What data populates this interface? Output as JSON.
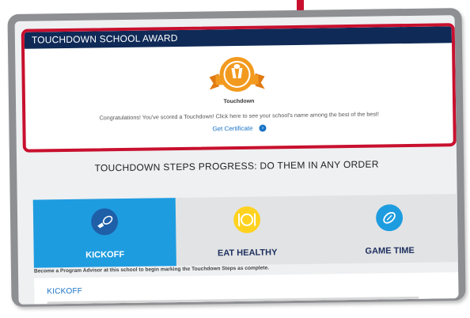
{
  "award": {
    "header": "TOUCHDOWN SCHOOL AWARD",
    "badge_label": "Touchdown",
    "message": "Congratulations! You've scored a Touchdown! Click here to see your school's name among the best of the best!",
    "certificate_link": "Get Certificate",
    "badge_color": "#f29a1f"
  },
  "progress": {
    "title": "TOUCHDOWN STEPS PROGRESS: DO THEM IN ANY ORDER",
    "tiles": [
      {
        "label": "KICKOFF",
        "icon": "kickoff-icon",
        "active": true,
        "color": "#1e5fa8"
      },
      {
        "label": "EAT HEALTHY",
        "icon": "plate-icon",
        "active": false,
        "color": "#ffd21f"
      },
      {
        "label": "GAME TIME",
        "icon": "football-icon",
        "active": false,
        "color": "#1e9ce0"
      }
    ],
    "notice": "Become a Program Advisor at this school to begin marking the Touchdown Steps as complete."
  },
  "kickoff_section": {
    "title": "KICKOFF"
  },
  "colors": {
    "highlight": "#c8102e",
    "header_bg": "#0f2a57",
    "active_tile": "#1e9ce0",
    "link": "#1a73c6"
  }
}
